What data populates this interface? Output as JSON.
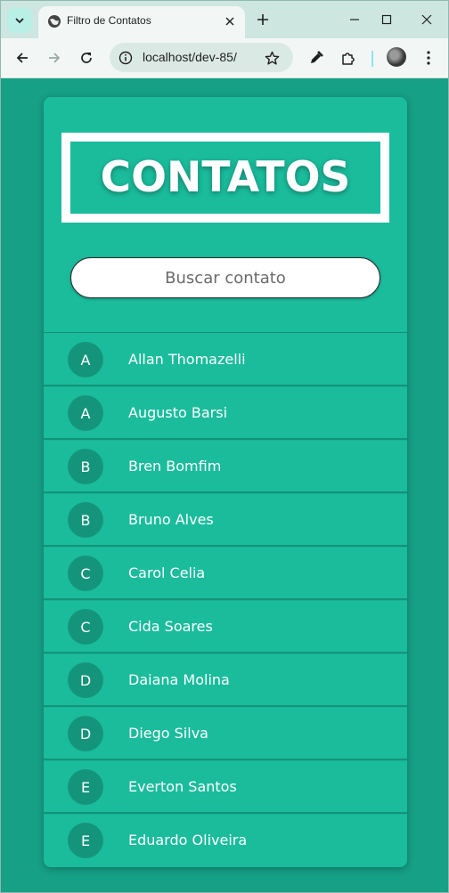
{
  "browser": {
    "tab_title": "Filtro de Contatos",
    "url": "localhost/dev-85/"
  },
  "page": {
    "title": "CONTATOS",
    "search": {
      "placeholder": "Buscar contato",
      "value": ""
    },
    "contacts": [
      {
        "initial": "A",
        "name": "Allan Thomazelli"
      },
      {
        "initial": "A",
        "name": "Augusto Barsi"
      },
      {
        "initial": "B",
        "name": "Bren Bomfim"
      },
      {
        "initial": "B",
        "name": "Bruno Alves"
      },
      {
        "initial": "C",
        "name": "Carol Celia"
      },
      {
        "initial": "C",
        "name": "Cida Soares"
      },
      {
        "initial": "D",
        "name": "Daiana Molina"
      },
      {
        "initial": "D",
        "name": "Diego Silva"
      },
      {
        "initial": "E",
        "name": "Everton Santos"
      },
      {
        "initial": "E",
        "name": "Eduardo Oliveira"
      }
    ]
  },
  "colors": {
    "page_bg": "#16a085",
    "card_bg": "#1abc9c",
    "initial_bg": "#14957b"
  }
}
